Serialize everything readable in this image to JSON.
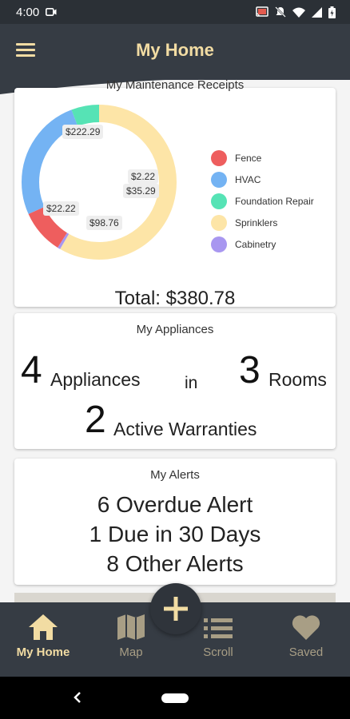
{
  "status_bar": {
    "time": "4:00"
  },
  "app_bar": {
    "title": "My Home"
  },
  "receipts": {
    "title": "My Maintenance Receipts",
    "total_label": "Total: $380.78",
    "chart_data": {
      "type": "pie",
      "title": "My Maintenance Receipts",
      "categories": [
        "Fence",
        "HVAC",
        "Foundation Repair",
        "Sprinklers",
        "Cabinetry"
      ],
      "values": [
        35.29,
        98.76,
        22.22,
        222.29,
        2.22
      ],
      "colors": [
        "#ee5e5e",
        "#74b3f3",
        "#56e3b5",
        "#fde5a7",
        "#a897f0"
      ],
      "labels": [
        "$35.29",
        "$98.76",
        "$22.22",
        "$222.29",
        "$2.22"
      ],
      "legend_position": "right"
    },
    "legend": [
      {
        "label": "Fence",
        "color": "#ee5e5e"
      },
      {
        "label": "HVAC",
        "color": "#74b3f3"
      },
      {
        "label": "Foundation Repair",
        "color": "#56e3b5"
      },
      {
        "label": "Sprinklers",
        "color": "#fde5a7"
      },
      {
        "label": "Cabinetry",
        "color": "#a897f0"
      }
    ]
  },
  "appliances": {
    "title": "My Appliances",
    "appliance_count": "4",
    "appliance_word": "Appliances",
    "in_word": "in",
    "room_count": "3",
    "room_word": "Rooms",
    "warranty_count": "2",
    "warranty_word": "Active Warranties"
  },
  "alerts": {
    "title": "My Alerts",
    "lines": [
      "6 Overdue Alert",
      "1 Due in 30 Days",
      "8 Other Alerts"
    ]
  },
  "bottom_nav": {
    "items": [
      {
        "label": "My Home",
        "icon": "home-icon"
      },
      {
        "label": "Map",
        "icon": "map-icon"
      },
      {
        "label": "Scroll",
        "icon": "list-icon"
      },
      {
        "label": "Saved",
        "icon": "heart-icon"
      }
    ],
    "fab_icon": "plus-icon"
  },
  "colors": {
    "app_bar": "#363c44",
    "accent": "#f2dca3",
    "nav_inactive": "#a89e85"
  }
}
